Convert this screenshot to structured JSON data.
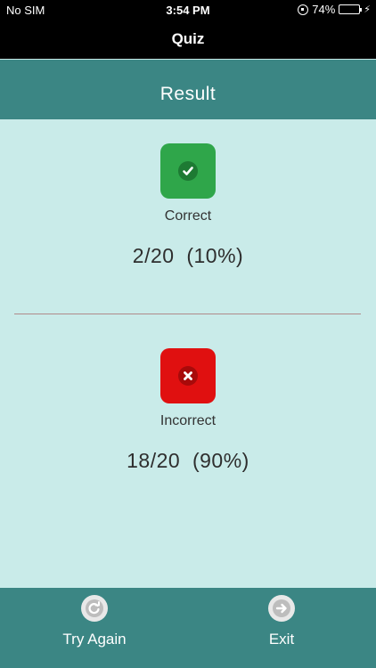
{
  "status": {
    "carrier": "No SIM",
    "time": "3:54 PM",
    "battery": "74%",
    "battery_level": 0.74
  },
  "nav": {
    "title": "Quiz"
  },
  "header": {
    "title": "Result"
  },
  "correct": {
    "label": "Correct",
    "value": "2/20  (10%)",
    "icon": "check-icon",
    "color": "#2fa64a"
  },
  "incorrect": {
    "label": "Incorrect",
    "value": "18/20  (90%)",
    "icon": "x-icon",
    "color": "#e01010"
  },
  "footer": {
    "try_again": "Try Again",
    "exit": "Exit"
  },
  "colors": {
    "teal": "#3b8684",
    "background": "#c9ebe9"
  }
}
